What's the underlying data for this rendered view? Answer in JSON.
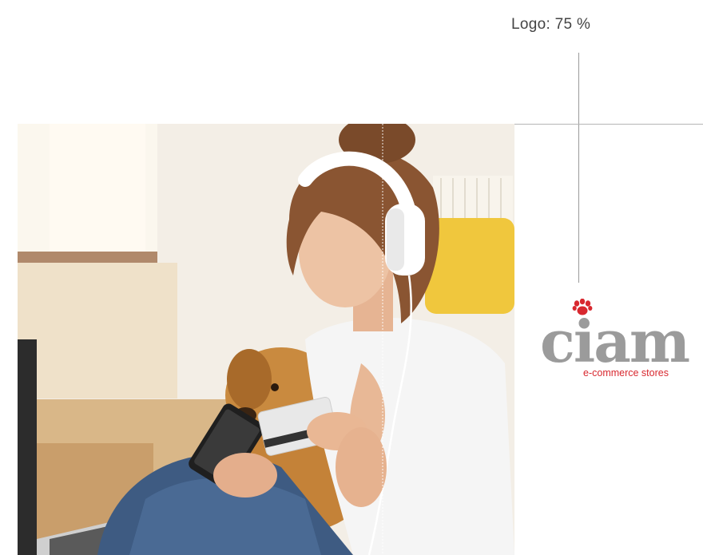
{
  "annotation": {
    "label": "Logo: 75 %"
  },
  "photo": {
    "subject_icon": "stock-photo"
  },
  "logo": {
    "wordmark": "ciam",
    "tagline": "e-commerce stores",
    "paw_icon": "paw-icon",
    "colors": {
      "wordmark": "#9b9b9b",
      "accent": "#d8282f"
    }
  }
}
